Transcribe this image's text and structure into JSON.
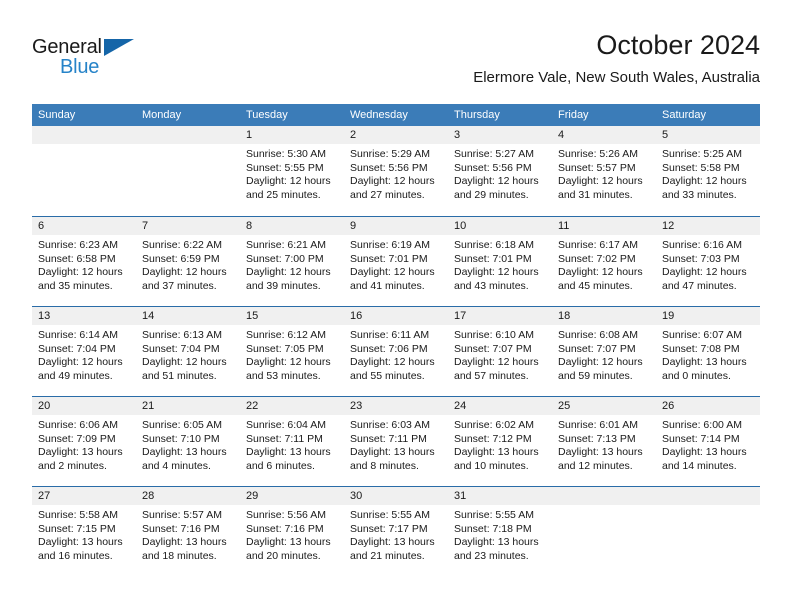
{
  "brand": {
    "name_dark": "General",
    "name_blue": "Blue",
    "triangle_color": "#1565a8",
    "blue_color": "#2683c8"
  },
  "header": {
    "title": "October 2024",
    "subtitle": "Elermore Vale, New South Wales, Australia"
  },
  "theme": {
    "header_row_bg": "#3b7cb8",
    "header_row_text": "#ffffff",
    "week_divider": "#2a6ca8",
    "day_band_bg": "#f0f0f0",
    "text": "#1a1a1a"
  },
  "calendar": {
    "weekday_headers": [
      "Sunday",
      "Monday",
      "Tuesday",
      "Wednesday",
      "Thursday",
      "Friday",
      "Saturday"
    ],
    "labels": {
      "sunrise": "Sunrise:",
      "sunset": "Sunset:",
      "daylight": "Daylight:"
    },
    "weeks": [
      [
        {
          "day": "",
          "empty": true
        },
        {
          "day": "",
          "empty": true
        },
        {
          "day": "1",
          "sunrise": "Sunrise: 5:30 AM",
          "sunset": "Sunset: 5:55 PM",
          "daylight_1": "Daylight: 12 hours",
          "daylight_2": "and 25 minutes."
        },
        {
          "day": "2",
          "sunrise": "Sunrise: 5:29 AM",
          "sunset": "Sunset: 5:56 PM",
          "daylight_1": "Daylight: 12 hours",
          "daylight_2": "and 27 minutes."
        },
        {
          "day": "3",
          "sunrise": "Sunrise: 5:27 AM",
          "sunset": "Sunset: 5:56 PM",
          "daylight_1": "Daylight: 12 hours",
          "daylight_2": "and 29 minutes."
        },
        {
          "day": "4",
          "sunrise": "Sunrise: 5:26 AM",
          "sunset": "Sunset: 5:57 PM",
          "daylight_1": "Daylight: 12 hours",
          "daylight_2": "and 31 minutes."
        },
        {
          "day": "5",
          "sunrise": "Sunrise: 5:25 AM",
          "sunset": "Sunset: 5:58 PM",
          "daylight_1": "Daylight: 12 hours",
          "daylight_2": "and 33 minutes."
        }
      ],
      [
        {
          "day": "6",
          "sunrise": "Sunrise: 6:23 AM",
          "sunset": "Sunset: 6:58 PM",
          "daylight_1": "Daylight: 12 hours",
          "daylight_2": "and 35 minutes."
        },
        {
          "day": "7",
          "sunrise": "Sunrise: 6:22 AM",
          "sunset": "Sunset: 6:59 PM",
          "daylight_1": "Daylight: 12 hours",
          "daylight_2": "and 37 minutes."
        },
        {
          "day": "8",
          "sunrise": "Sunrise: 6:21 AM",
          "sunset": "Sunset: 7:00 PM",
          "daylight_1": "Daylight: 12 hours",
          "daylight_2": "and 39 minutes."
        },
        {
          "day": "9",
          "sunrise": "Sunrise: 6:19 AM",
          "sunset": "Sunset: 7:01 PM",
          "daylight_1": "Daylight: 12 hours",
          "daylight_2": "and 41 minutes."
        },
        {
          "day": "10",
          "sunrise": "Sunrise: 6:18 AM",
          "sunset": "Sunset: 7:01 PM",
          "daylight_1": "Daylight: 12 hours",
          "daylight_2": "and 43 minutes."
        },
        {
          "day": "11",
          "sunrise": "Sunrise: 6:17 AM",
          "sunset": "Sunset: 7:02 PM",
          "daylight_1": "Daylight: 12 hours",
          "daylight_2": "and 45 minutes."
        },
        {
          "day": "12",
          "sunrise": "Sunrise: 6:16 AM",
          "sunset": "Sunset: 7:03 PM",
          "daylight_1": "Daylight: 12 hours",
          "daylight_2": "and 47 minutes."
        }
      ],
      [
        {
          "day": "13",
          "sunrise": "Sunrise: 6:14 AM",
          "sunset": "Sunset: 7:04 PM",
          "daylight_1": "Daylight: 12 hours",
          "daylight_2": "and 49 minutes."
        },
        {
          "day": "14",
          "sunrise": "Sunrise: 6:13 AM",
          "sunset": "Sunset: 7:04 PM",
          "daylight_1": "Daylight: 12 hours",
          "daylight_2": "and 51 minutes."
        },
        {
          "day": "15",
          "sunrise": "Sunrise: 6:12 AM",
          "sunset": "Sunset: 7:05 PM",
          "daylight_1": "Daylight: 12 hours",
          "daylight_2": "and 53 minutes."
        },
        {
          "day": "16",
          "sunrise": "Sunrise: 6:11 AM",
          "sunset": "Sunset: 7:06 PM",
          "daylight_1": "Daylight: 12 hours",
          "daylight_2": "and 55 minutes."
        },
        {
          "day": "17",
          "sunrise": "Sunrise: 6:10 AM",
          "sunset": "Sunset: 7:07 PM",
          "daylight_1": "Daylight: 12 hours",
          "daylight_2": "and 57 minutes."
        },
        {
          "day": "18",
          "sunrise": "Sunrise: 6:08 AM",
          "sunset": "Sunset: 7:07 PM",
          "daylight_1": "Daylight: 12 hours",
          "daylight_2": "and 59 minutes."
        },
        {
          "day": "19",
          "sunrise": "Sunrise: 6:07 AM",
          "sunset": "Sunset: 7:08 PM",
          "daylight_1": "Daylight: 13 hours",
          "daylight_2": "and 0 minutes."
        }
      ],
      [
        {
          "day": "20",
          "sunrise": "Sunrise: 6:06 AM",
          "sunset": "Sunset: 7:09 PM",
          "daylight_1": "Daylight: 13 hours",
          "daylight_2": "and 2 minutes."
        },
        {
          "day": "21",
          "sunrise": "Sunrise: 6:05 AM",
          "sunset": "Sunset: 7:10 PM",
          "daylight_1": "Daylight: 13 hours",
          "daylight_2": "and 4 minutes."
        },
        {
          "day": "22",
          "sunrise": "Sunrise: 6:04 AM",
          "sunset": "Sunset: 7:11 PM",
          "daylight_1": "Daylight: 13 hours",
          "daylight_2": "and 6 minutes."
        },
        {
          "day": "23",
          "sunrise": "Sunrise: 6:03 AM",
          "sunset": "Sunset: 7:11 PM",
          "daylight_1": "Daylight: 13 hours",
          "daylight_2": "and 8 minutes."
        },
        {
          "day": "24",
          "sunrise": "Sunrise: 6:02 AM",
          "sunset": "Sunset: 7:12 PM",
          "daylight_1": "Daylight: 13 hours",
          "daylight_2": "and 10 minutes."
        },
        {
          "day": "25",
          "sunrise": "Sunrise: 6:01 AM",
          "sunset": "Sunset: 7:13 PM",
          "daylight_1": "Daylight: 13 hours",
          "daylight_2": "and 12 minutes."
        },
        {
          "day": "26",
          "sunrise": "Sunrise: 6:00 AM",
          "sunset": "Sunset: 7:14 PM",
          "daylight_1": "Daylight: 13 hours",
          "daylight_2": "and 14 minutes."
        }
      ],
      [
        {
          "day": "27",
          "sunrise": "Sunrise: 5:58 AM",
          "sunset": "Sunset: 7:15 PM",
          "daylight_1": "Daylight: 13 hours",
          "daylight_2": "and 16 minutes."
        },
        {
          "day": "28",
          "sunrise": "Sunrise: 5:57 AM",
          "sunset": "Sunset: 7:16 PM",
          "daylight_1": "Daylight: 13 hours",
          "daylight_2": "and 18 minutes."
        },
        {
          "day": "29",
          "sunrise": "Sunrise: 5:56 AM",
          "sunset": "Sunset: 7:16 PM",
          "daylight_1": "Daylight: 13 hours",
          "daylight_2": "and 20 minutes."
        },
        {
          "day": "30",
          "sunrise": "Sunrise: 5:55 AM",
          "sunset": "Sunset: 7:17 PM",
          "daylight_1": "Daylight: 13 hours",
          "daylight_2": "and 21 minutes."
        },
        {
          "day": "31",
          "sunrise": "Sunrise: 5:55 AM",
          "sunset": "Sunset: 7:18 PM",
          "daylight_1": "Daylight: 13 hours",
          "daylight_2": "and 23 minutes."
        },
        {
          "day": "",
          "empty": true
        },
        {
          "day": "",
          "empty": true
        }
      ]
    ]
  }
}
